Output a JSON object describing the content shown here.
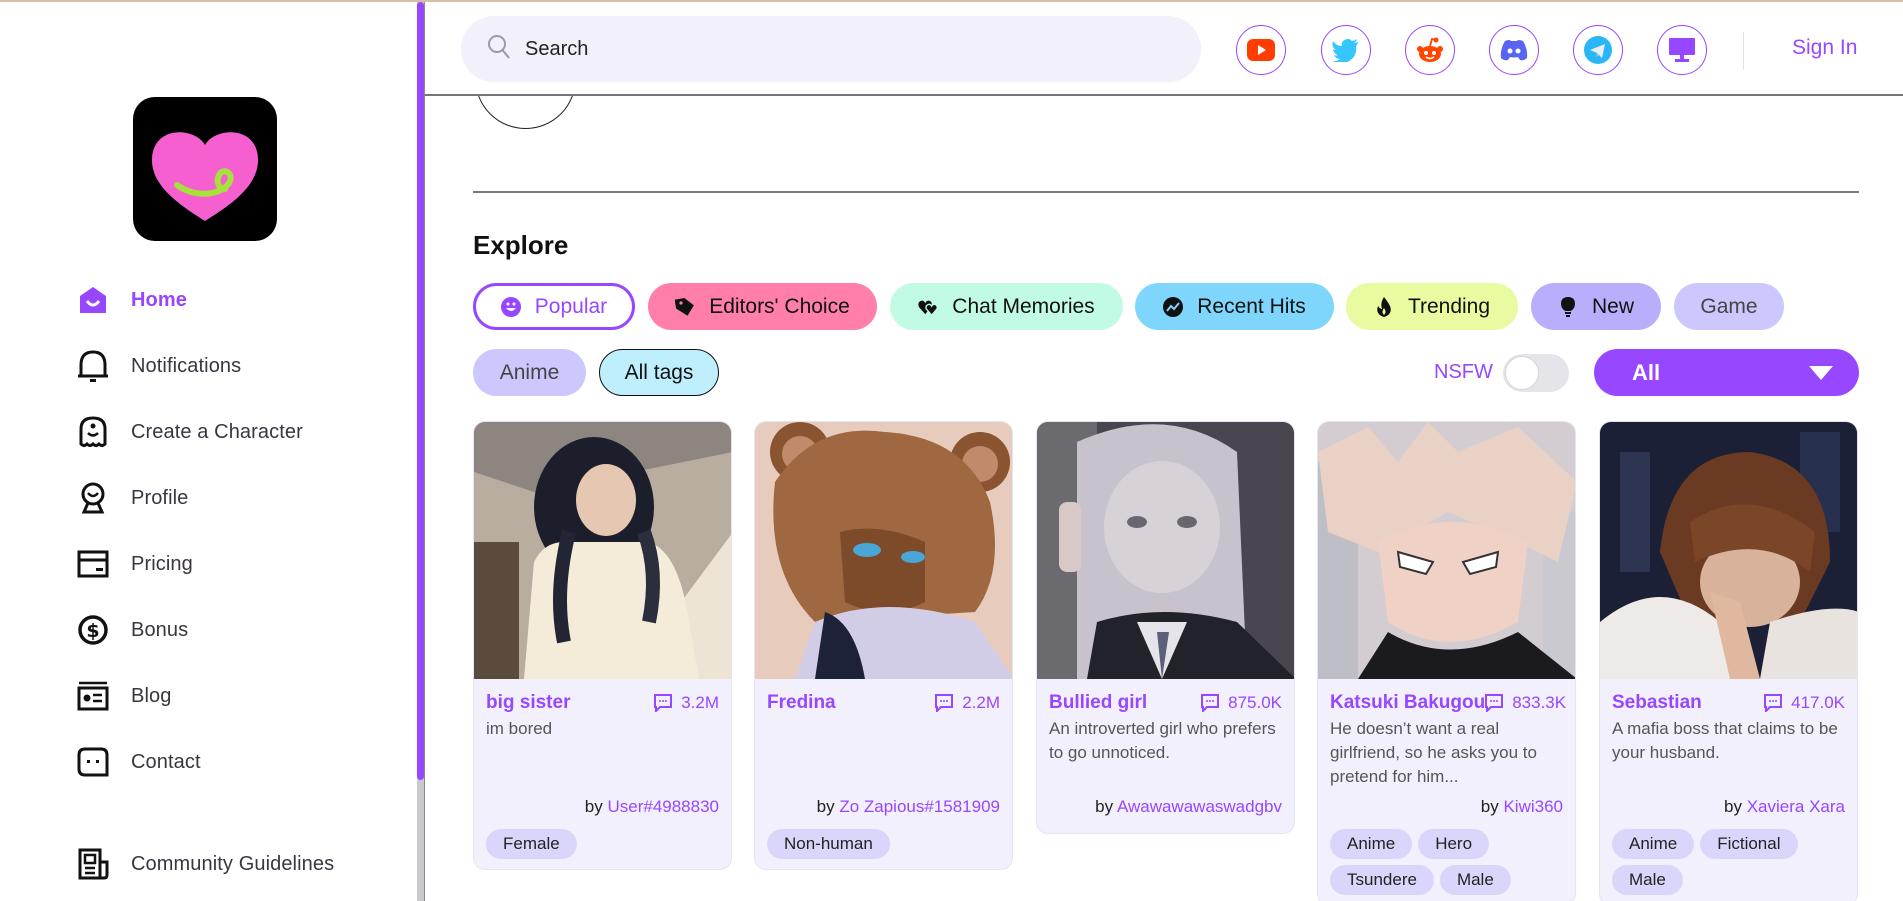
{
  "sidebar": {
    "logo_alt": "heart logo",
    "items": [
      {
        "label": "Home",
        "icon": "home-icon",
        "active": true
      },
      {
        "label": "Notifications",
        "icon": "bell-icon"
      },
      {
        "label": "Create a Character",
        "icon": "ghost-icon"
      },
      {
        "label": "Profile",
        "icon": "profile-icon"
      },
      {
        "label": "Pricing",
        "icon": "card-icon"
      },
      {
        "label": "Bonus",
        "icon": "dollar-icon"
      },
      {
        "label": "Blog",
        "icon": "blog-icon"
      },
      {
        "label": "Contact",
        "icon": "chat-icon"
      },
      {
        "label": "Community Guidelines",
        "icon": "newspaper-icon"
      }
    ]
  },
  "header": {
    "search_placeholder": "Search",
    "socials": [
      "youtube",
      "twitter",
      "reddit",
      "discord",
      "telegram",
      "desktop"
    ],
    "sign_in": "Sign In"
  },
  "explore": {
    "title": "Explore",
    "chips": [
      {
        "label": "Popular",
        "icon": "smile-icon",
        "bg": "#ffffff",
        "selected": true
      },
      {
        "label": "Editors' Choice",
        "icon": "tag-icon",
        "bg": "#ff7eaa"
      },
      {
        "label": "Chat Memories",
        "icon": "hearts-icon",
        "bg": "#c2fbe3"
      },
      {
        "label": "Recent Hits",
        "icon": "trend-icon",
        "bg": "#7fd6fd"
      },
      {
        "label": "Trending",
        "icon": "flame-icon",
        "bg": "#e8fba0"
      },
      {
        "label": "New",
        "icon": "bulb-icon",
        "bg": "#b8aefc"
      },
      {
        "label": "Game",
        "bg": "#ccc7fd"
      },
      {
        "label": "Anime",
        "bg": "#ccc7fd"
      },
      {
        "label": "All tags",
        "bg": "#bfeefd"
      }
    ],
    "nsfw_label": "NSFW",
    "nsfw_on": false,
    "filter_value": "All"
  },
  "cards": [
    {
      "name": "big sister",
      "count": "3.2M",
      "desc": "im bored",
      "by": "by",
      "author": "User#4988830",
      "tags": [
        "Female"
      ]
    },
    {
      "name": "Fredina",
      "count": "2.2M",
      "desc": "",
      "by": "by",
      "author": "Zo Zapious#1581909",
      "tags": [
        "Non-human"
      ]
    },
    {
      "name": "Bullied girl",
      "count": "875.0K",
      "desc": "An introverted girl who prefers to go unnoticed.",
      "by": "by",
      "author": "Awawawawaswadgbv",
      "tags": []
    },
    {
      "name": "Katsuki Bakugou",
      "count": "833.3K",
      "desc": "He doesn’t want a real girlfriend, so he asks you to pretend for him...",
      "by": "by",
      "author": "Kiwi360",
      "tags": [
        "Anime",
        "Hero",
        "Tsundere",
        "Male"
      ]
    },
    {
      "name": "Sebastian",
      "count": "417.0K",
      "desc": "A mafia boss that claims to be your husband.",
      "by": "by",
      "author": "Xaviera Xara",
      "tags": [
        "Anime",
        "Fictional",
        "Male"
      ]
    }
  ],
  "colors": {
    "accent": "#9747ff",
    "card_bg": "#f3f0fd",
    "tag_bg": "#dad6fb",
    "search_bg": "#f2f0fb"
  }
}
